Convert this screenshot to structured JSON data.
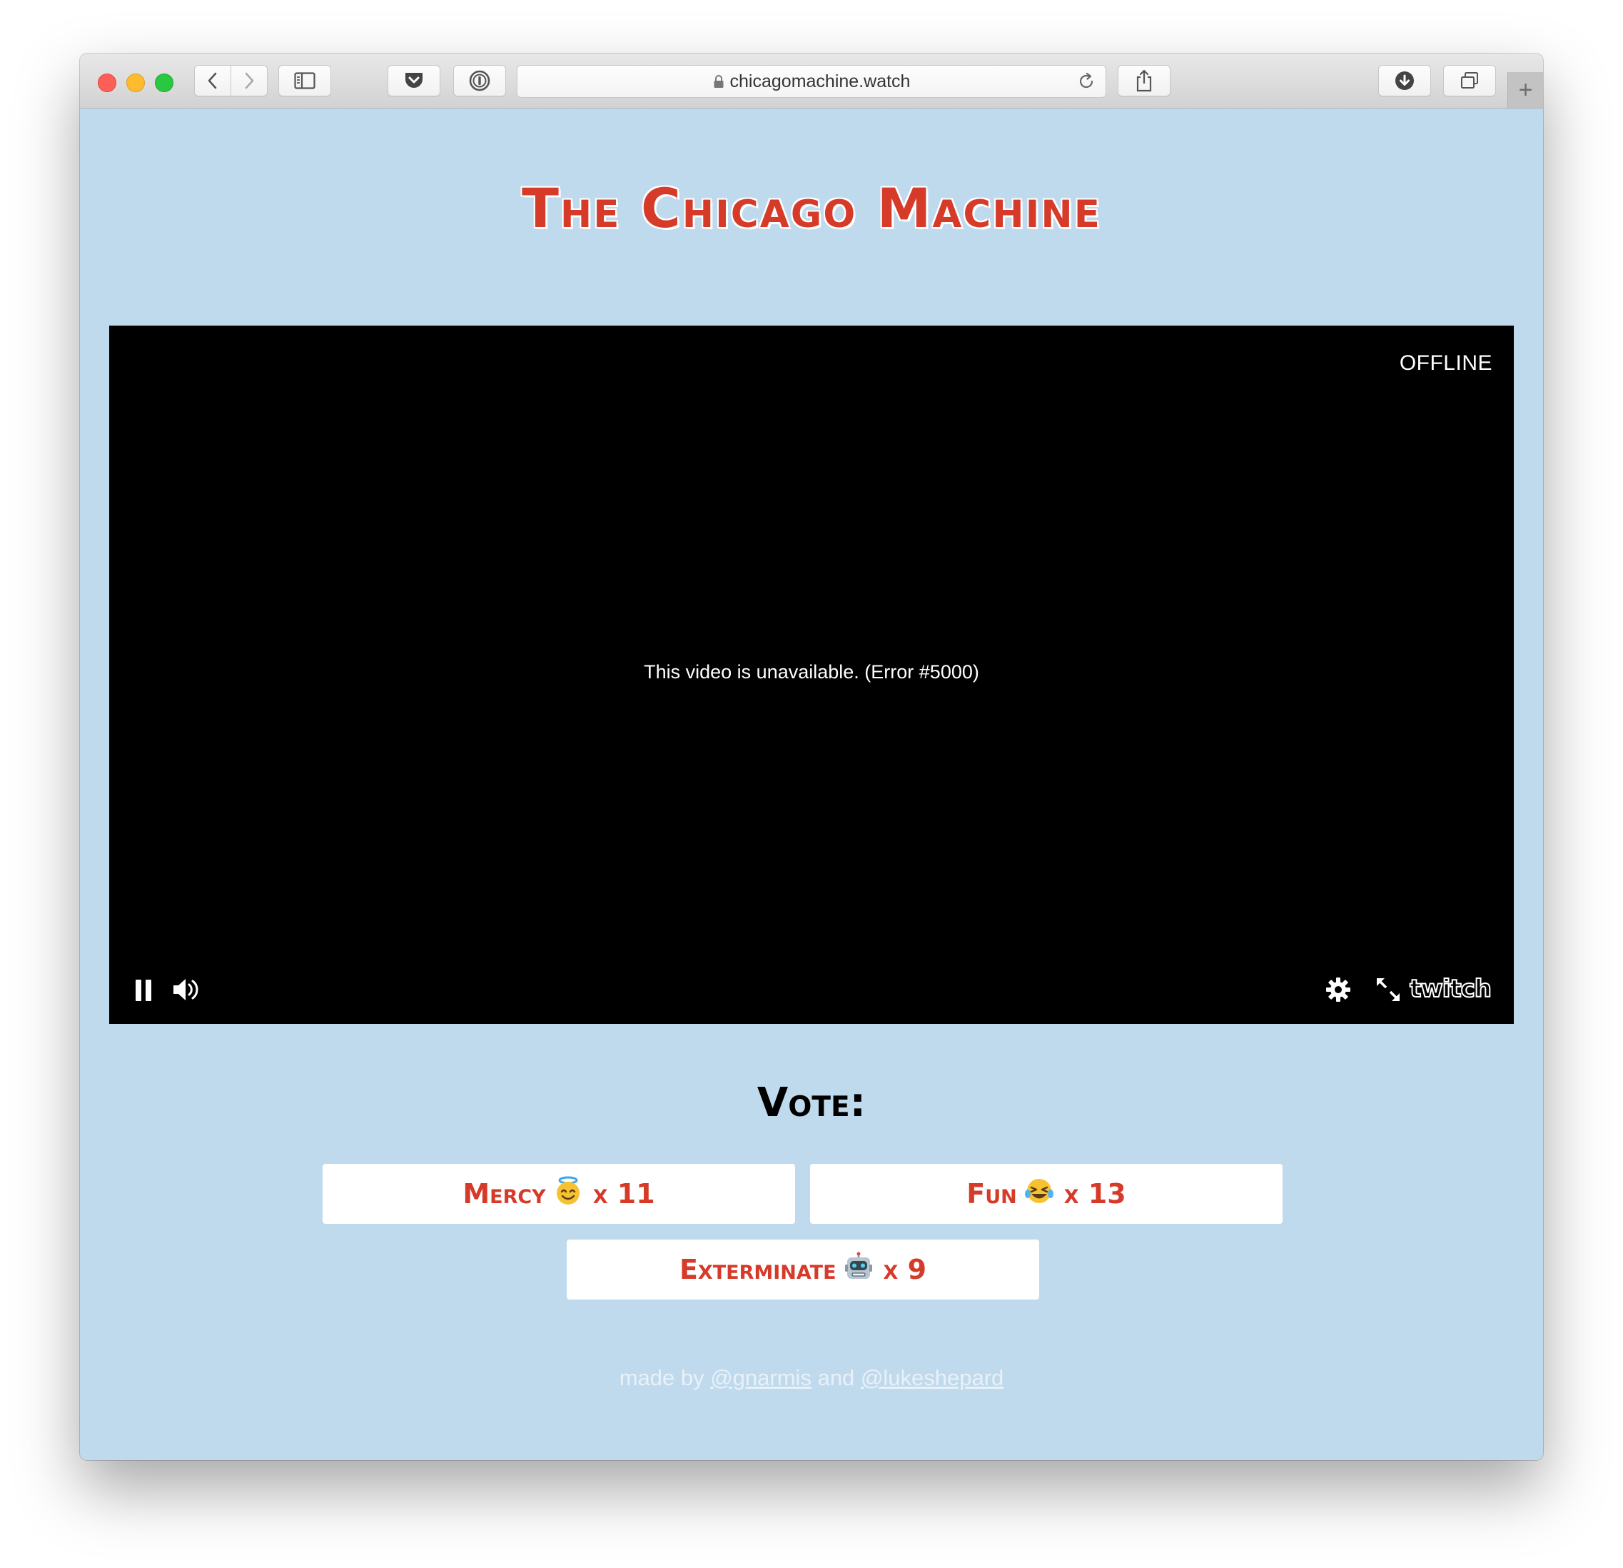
{
  "browser": {
    "url": "chicagomachine.watch",
    "new_tab_glyph": "+"
  },
  "page": {
    "title": "The Chicago Machine",
    "vote_heading": "Vote:",
    "footer": {
      "prefix": "made by",
      "link1": "@gnarmis",
      "joiner": "and",
      "link2": "@lukeshepard"
    }
  },
  "player": {
    "status": "OFFLINE",
    "error_message": "This video is unavailable. (Error #5000)",
    "brand": "twitch"
  },
  "votes": [
    {
      "label": "Mercy",
      "emoji_icon": "angel-smiley-icon",
      "count": "x 11"
    },
    {
      "label": "Fun",
      "emoji_icon": "laughing-tears-icon",
      "count": "x 13"
    },
    {
      "label": "Exterminate",
      "emoji_icon": "robot-face-icon",
      "count": "x 9"
    }
  ],
  "colors": {
    "page_background": "#c0daed",
    "accent_red": "#d63a29",
    "player_background": "#000000"
  }
}
